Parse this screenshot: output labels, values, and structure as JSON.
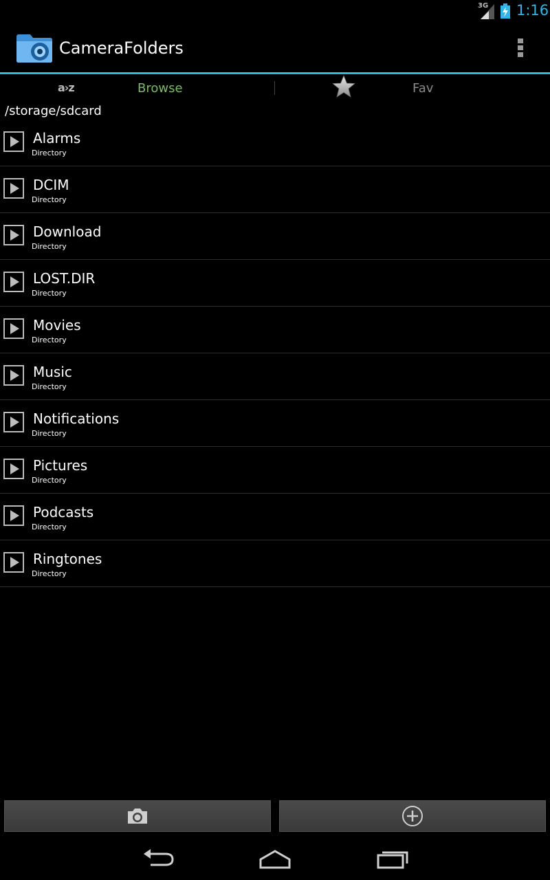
{
  "status_bar": {
    "network": "3G",
    "time": "1:16"
  },
  "action_bar": {
    "title": "CameraFolders",
    "icon": "folder-camera-icon",
    "overflow_icon": "overflow-menu-icon"
  },
  "tabs": [
    {
      "label": "Browse",
      "icon": "az-sort-icon",
      "icon_text": "a›z",
      "selected": true,
      "color": "#7cba6a"
    },
    {
      "label": "Fav",
      "icon": "star-icon",
      "selected": false,
      "color": "#8a8a8a"
    }
  ],
  "path": "/storage/sdcard",
  "items": [
    {
      "name": "Alarms",
      "type": "Directory"
    },
    {
      "name": "DCIM",
      "type": "Directory"
    },
    {
      "name": "Download",
      "type": "Directory"
    },
    {
      "name": "LOST.DIR",
      "type": "Directory"
    },
    {
      "name": "Movies",
      "type": "Directory"
    },
    {
      "name": "Music",
      "type": "Directory"
    },
    {
      "name": "Notifications",
      "type": "Directory"
    },
    {
      "name": "Pictures",
      "type": "Directory"
    },
    {
      "name": "Podcasts",
      "type": "Directory"
    },
    {
      "name": "Ringtones",
      "type": "Directory"
    }
  ],
  "bottom_buttons": [
    {
      "icon": "camera-icon"
    },
    {
      "icon": "add-circle-icon"
    }
  ],
  "nav": [
    "back-icon",
    "home-icon",
    "recent-apps-icon"
  ],
  "colors": {
    "accent": "#33b5e5",
    "selected_tab": "#7cba6a"
  }
}
